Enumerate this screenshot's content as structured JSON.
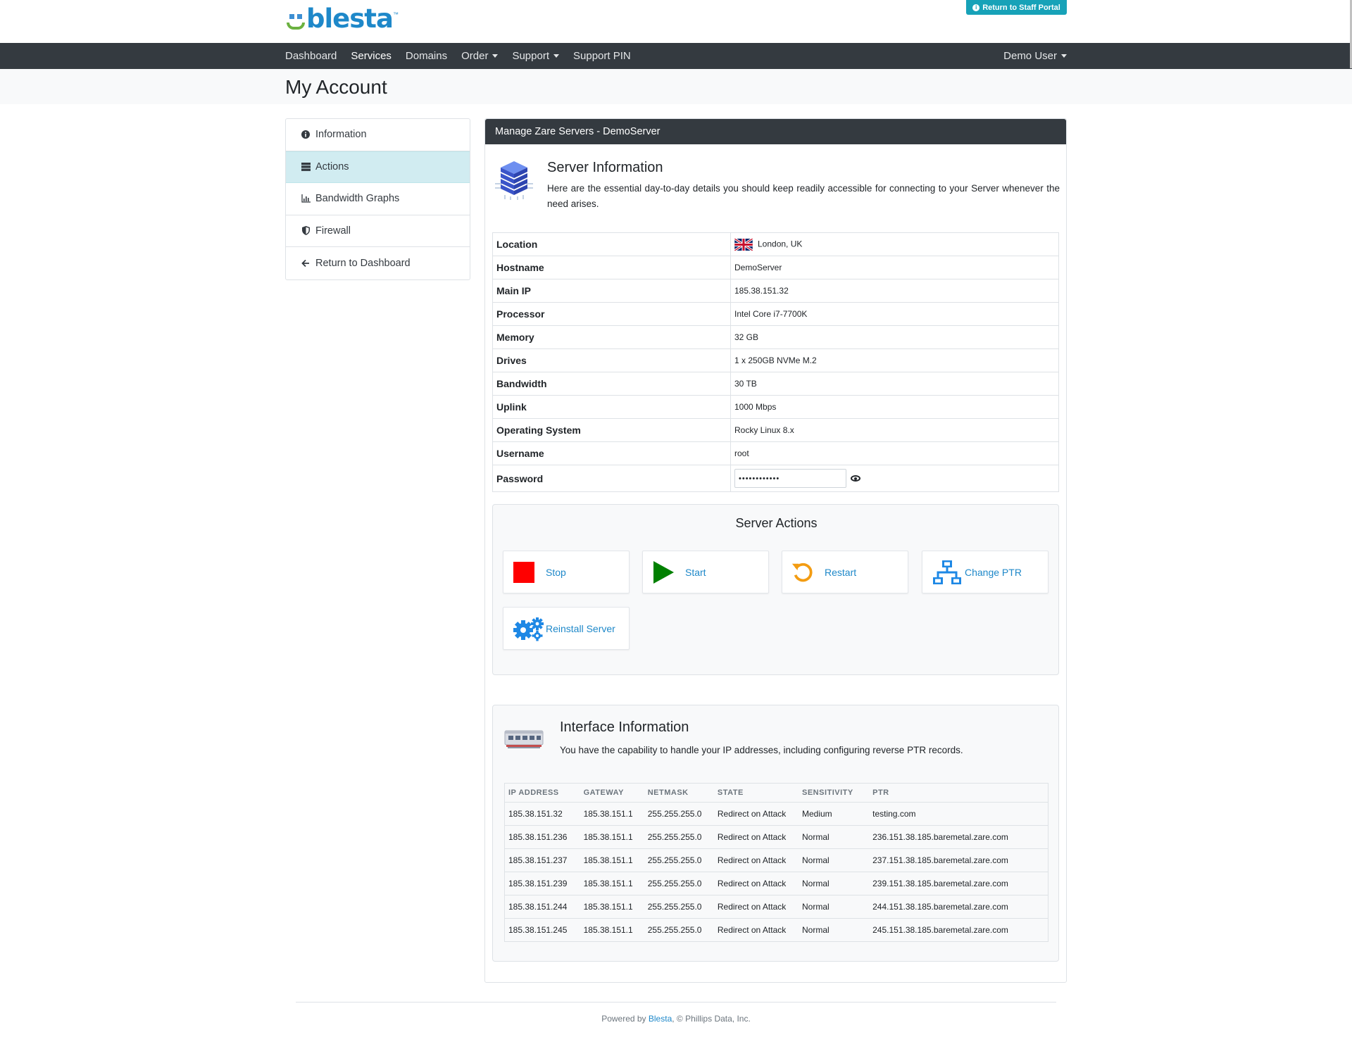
{
  "header": {
    "logo_text": "blesta",
    "logo_tm": "™",
    "staff_portal_label": "Return to Staff Portal"
  },
  "nav": {
    "items": [
      {
        "label": "Dashboard",
        "active": false,
        "dropdown": false
      },
      {
        "label": "Services",
        "active": true,
        "dropdown": false
      },
      {
        "label": "Domains",
        "active": false,
        "dropdown": false
      },
      {
        "label": "Order",
        "active": false,
        "dropdown": true
      },
      {
        "label": "Support",
        "active": false,
        "dropdown": true
      },
      {
        "label": "Support PIN",
        "active": false,
        "dropdown": false
      }
    ],
    "user_label": "Demo User"
  },
  "page": {
    "title": "My Account"
  },
  "sidebar": {
    "items": [
      {
        "label": "Information",
        "icon": "info-circle-icon",
        "active": false
      },
      {
        "label": "Actions",
        "icon": "server-icon",
        "active": true
      },
      {
        "label": "Bandwidth Graphs",
        "icon": "bar-chart-icon",
        "active": false
      },
      {
        "label": "Firewall",
        "icon": "shield-icon",
        "active": false
      },
      {
        "label": "Return to Dashboard",
        "icon": "arrow-left-icon",
        "active": false
      }
    ]
  },
  "card": {
    "title": "Manage Zare Servers - DemoServer"
  },
  "server_info": {
    "title": "Server Information",
    "description": "Here are the essential day-to-day details you should keep readily accessible for connecting to your Server whenever the need arises.",
    "rows": [
      {
        "key": "Location",
        "value": "London, UK"
      },
      {
        "key": "Hostname",
        "value": "DemoServer"
      },
      {
        "key": "Main IP",
        "value": "185.38.151.32"
      },
      {
        "key": "Processor",
        "value": "Intel Core i7-7700K"
      },
      {
        "key": "Memory",
        "value": "32 GB"
      },
      {
        "key": "Drives",
        "value": "1 x 250GB NVMe M.2"
      },
      {
        "key": "Bandwidth",
        "value": "30 TB"
      },
      {
        "key": "Uplink",
        "value": "1000 Mbps"
      },
      {
        "key": "Operating System",
        "value": "Rocky Linux 8.x"
      },
      {
        "key": "Username",
        "value": "root"
      }
    ],
    "password_label": "Password",
    "password_value": "••••••••••••"
  },
  "server_actions": {
    "title": "Server Actions",
    "buttons": [
      {
        "label": "Stop",
        "icon": "stop-icon",
        "color": "#ff0000"
      },
      {
        "label": "Start",
        "icon": "play-icon",
        "color": "#008000"
      },
      {
        "label": "Restart",
        "icon": "restart-icon",
        "color": "#f39c12"
      },
      {
        "label": "Change PTR",
        "icon": "network-icon",
        "color": "#1e88e5"
      },
      {
        "label": "Reinstall Server",
        "icon": "gears-icon",
        "color": "#1e88e5"
      }
    ]
  },
  "interface": {
    "title": "Interface Information",
    "description": "You have the capability to handle your IP addresses, including configuring reverse PTR records.",
    "columns": [
      "IP ADDRESS",
      "GATEWAY",
      "NETMASK",
      "STATE",
      "SENSITIVITY",
      "PTR"
    ],
    "rows": [
      [
        "185.38.151.32",
        "185.38.151.1",
        "255.255.255.0",
        "Redirect on Attack",
        "Medium",
        "testing.com"
      ],
      [
        "185.38.151.236",
        "185.38.151.1",
        "255.255.255.0",
        "Redirect on Attack",
        "Normal",
        "236.151.38.185.baremetal.zare.com"
      ],
      [
        "185.38.151.237",
        "185.38.151.1",
        "255.255.255.0",
        "Redirect on Attack",
        "Normal",
        "237.151.38.185.baremetal.zare.com"
      ],
      [
        "185.38.151.239",
        "185.38.151.1",
        "255.255.255.0",
        "Redirect on Attack",
        "Normal",
        "239.151.38.185.baremetal.zare.com"
      ],
      [
        "185.38.151.244",
        "185.38.151.1",
        "255.255.255.0",
        "Redirect on Attack",
        "Normal",
        "244.151.38.185.baremetal.zare.com"
      ],
      [
        "185.38.151.245",
        "185.38.151.1",
        "255.255.255.0",
        "Redirect on Attack",
        "Normal",
        "245.151.38.185.baremetal.zare.com"
      ]
    ]
  },
  "footer": {
    "prefix": "Powered by ",
    "link": "Blesta",
    "suffix": ", © Phillips Data, Inc."
  },
  "colors": {
    "nav_bg": "#343a40",
    "accent": "#1e88c9",
    "staff_button": "#17a2b8",
    "active_side": "#d1ecf1"
  }
}
